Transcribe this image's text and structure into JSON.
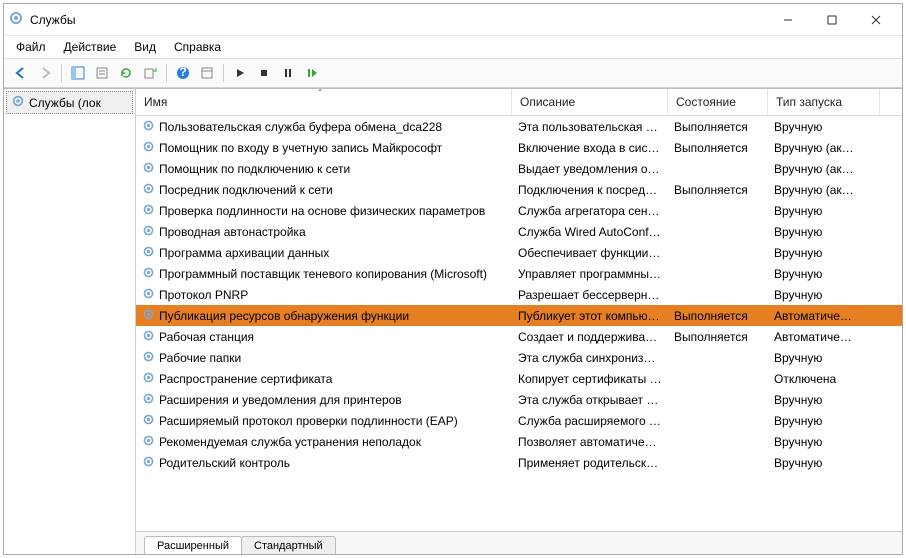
{
  "window": {
    "title": "Службы"
  },
  "menu": {
    "file": "Файл",
    "action": "Действие",
    "view": "Вид",
    "help": "Справка"
  },
  "tree": {
    "root": "Службы (лок"
  },
  "columns": {
    "name": "Имя",
    "desc": "Описание",
    "state": "Состояние",
    "start": "Тип запуска"
  },
  "rows": [
    {
      "name": "Пользовательская служба буфера обмена_dca228",
      "desc": "Эта пользовательская с…",
      "state": "Выполняется",
      "start": "Вручную"
    },
    {
      "name": "Помощник по входу в учетную запись Майкрософт",
      "desc": "Включение входа в сист…",
      "state": "Выполняется",
      "start": "Вручную (ак…"
    },
    {
      "name": "Помощник по подключению к сети",
      "desc": "Выдает уведомления о с…",
      "state": "",
      "start": "Вручную (ак…"
    },
    {
      "name": "Посредник подключений к сети",
      "desc": "Подключения к посредн…",
      "state": "Выполняется",
      "start": "Вручную (ак…"
    },
    {
      "name": "Проверка подлинности на основе физических параметров",
      "desc": "Служба агрегатора сенс…",
      "state": "",
      "start": "Вручную"
    },
    {
      "name": "Проводная автонастройка",
      "desc": "Служба Wired AutoConfi…",
      "state": "",
      "start": "Вручную"
    },
    {
      "name": "Программа архивации данных",
      "desc": "Обеспечивает функции …",
      "state": "",
      "start": "Вручную"
    },
    {
      "name": "Программный поставщик теневого копирования (Microsoft)",
      "desc": "Управляет программны…",
      "state": "",
      "start": "Вручную"
    },
    {
      "name": "Протокол PNRP",
      "desc": "Разрешает бессерверно…",
      "state": "",
      "start": "Вручную"
    },
    {
      "name": "Публикация ресурсов обнаружения функции",
      "desc": "Публикует этот компью…",
      "state": "Выполняется",
      "start": "Автоматиче…",
      "selected": true
    },
    {
      "name": "Рабочая станция",
      "desc": "Создает и поддерживает …",
      "state": "Выполняется",
      "start": "Автоматиче…"
    },
    {
      "name": "Рабочие папки",
      "desc": "Эта служба синхронизир…",
      "state": "",
      "start": "Вручную"
    },
    {
      "name": "Распространение сертификата",
      "desc": "Копирует сертификаты …",
      "state": "",
      "start": "Отключена"
    },
    {
      "name": "Расширения и уведомления для принтеров",
      "desc": "Эта служба открывает п…",
      "state": "",
      "start": "Вручную"
    },
    {
      "name": "Расширяемый протокол проверки подлинности (EAP)",
      "desc": "Служба расширяемого п…",
      "state": "",
      "start": "Вручную"
    },
    {
      "name": "Рекомендуемая служба устранения неполадок",
      "desc": "Позволяет автоматичес…",
      "state": "",
      "start": "Вручную"
    },
    {
      "name": "Родительский контроль",
      "desc": "Применяет родительски…",
      "state": "",
      "start": "Вручную"
    }
  ],
  "tabs": {
    "extended": "Расширенный",
    "standard": "Стандартный"
  }
}
